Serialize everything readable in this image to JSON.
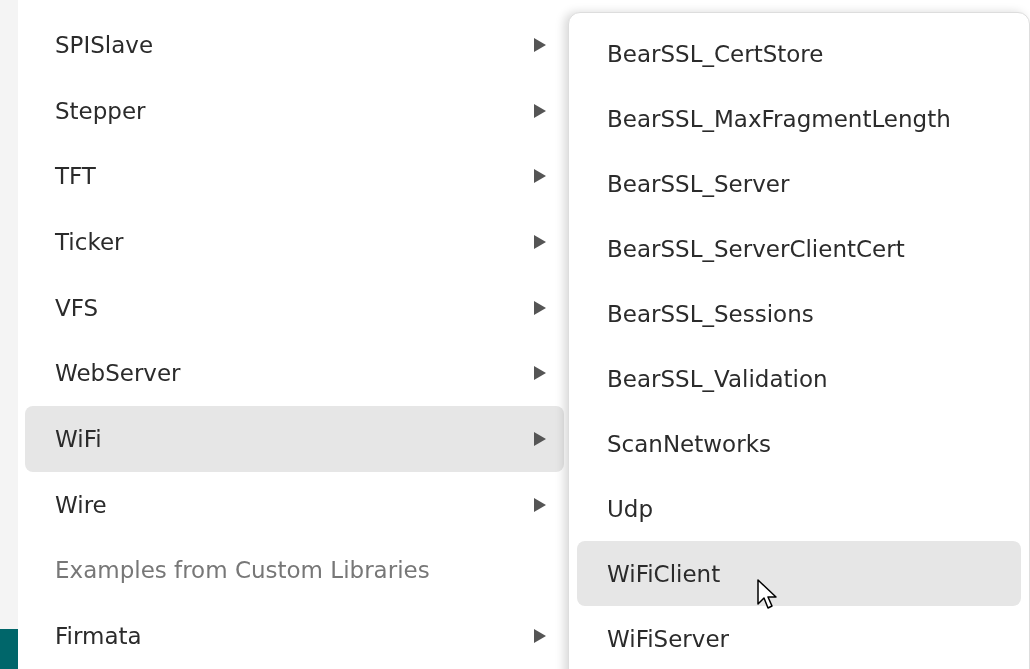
{
  "menu": {
    "items": [
      {
        "label": "SPISlave",
        "kind": "submenu",
        "selected": false
      },
      {
        "label": "Stepper",
        "kind": "submenu",
        "selected": false
      },
      {
        "label": "TFT",
        "kind": "submenu",
        "selected": false
      },
      {
        "label": "Ticker",
        "kind": "submenu",
        "selected": false
      },
      {
        "label": "VFS",
        "kind": "submenu",
        "selected": false
      },
      {
        "label": "WebServer",
        "kind": "submenu",
        "selected": false
      },
      {
        "label": "WiFi",
        "kind": "submenu",
        "selected": true
      },
      {
        "label": "Wire",
        "kind": "submenu",
        "selected": false
      },
      {
        "label": "Examples from Custom Libraries",
        "kind": "header",
        "selected": false
      },
      {
        "label": "Firmata",
        "kind": "submenu",
        "selected": false
      }
    ]
  },
  "submenu": {
    "items": [
      {
        "label": "BearSSL_CertStore",
        "selected": false
      },
      {
        "label": "BearSSL_MaxFragmentLength",
        "selected": false
      },
      {
        "label": "BearSSL_Server",
        "selected": false
      },
      {
        "label": "BearSSL_ServerClientCert",
        "selected": false
      },
      {
        "label": "BearSSL_Sessions",
        "selected": false
      },
      {
        "label": "BearSSL_Validation",
        "selected": false
      },
      {
        "label": "ScanNetworks",
        "selected": false
      },
      {
        "label": "Udp",
        "selected": false
      },
      {
        "label": "WiFiClient",
        "selected": true
      },
      {
        "label": "WiFiServer",
        "selected": false
      }
    ]
  }
}
